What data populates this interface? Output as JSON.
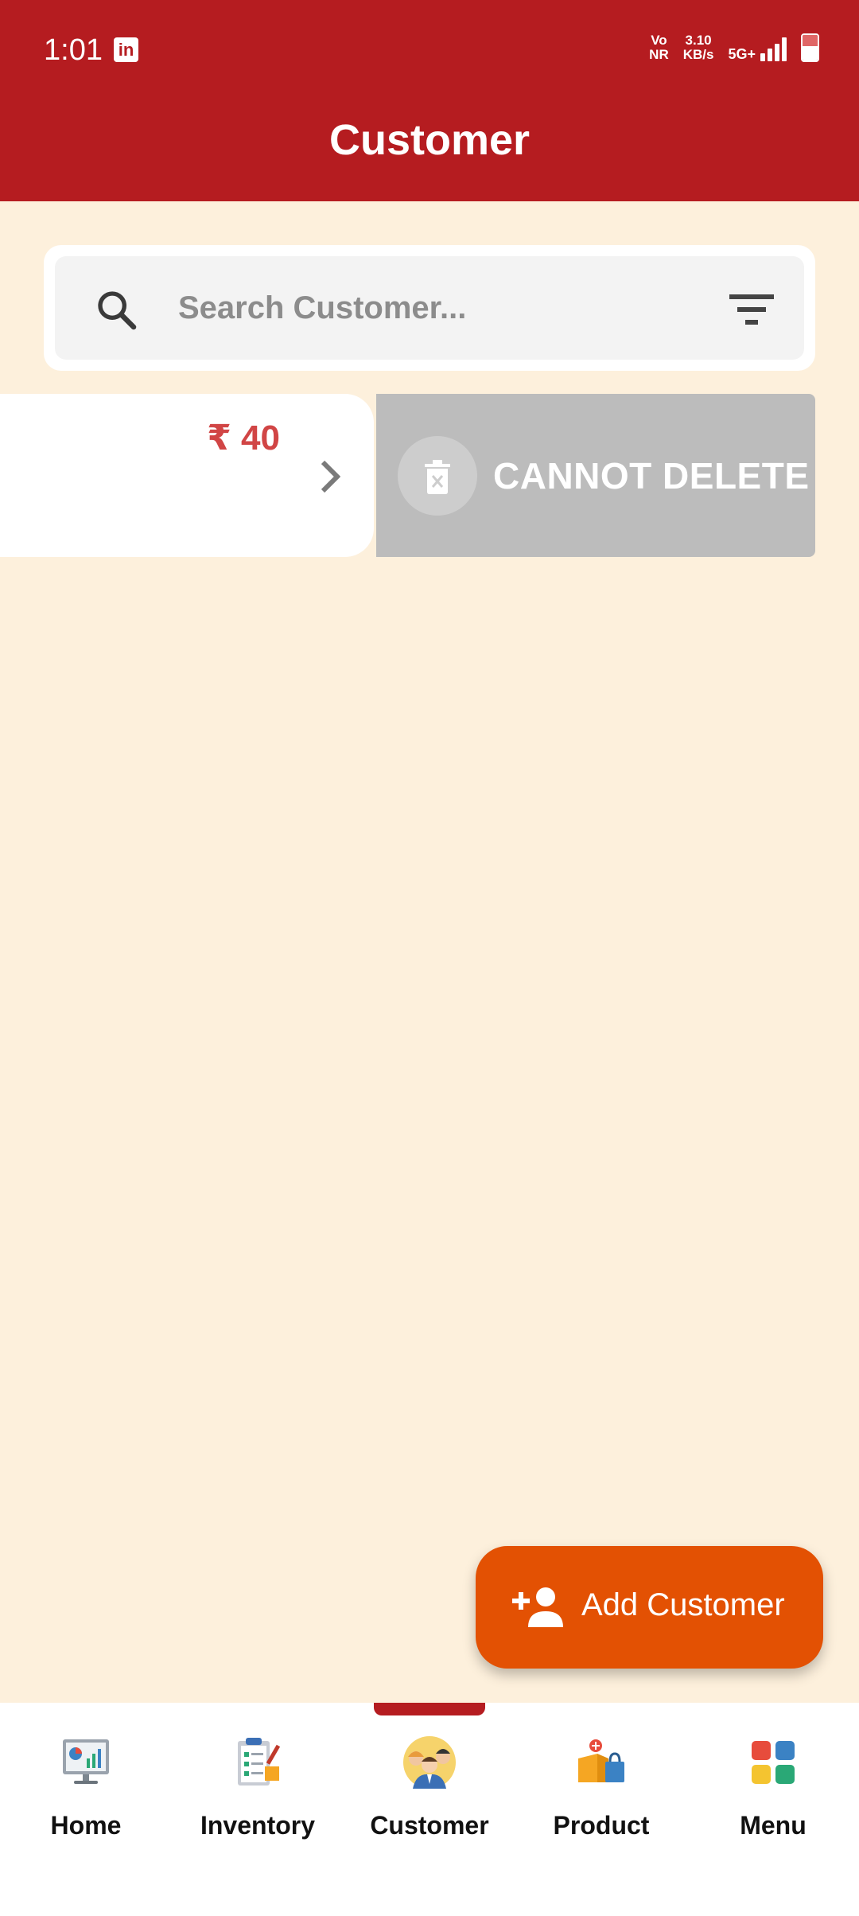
{
  "status_bar": {
    "time": "1:01",
    "linkedin_icon": "in",
    "network_top": "Vo",
    "network_bottom": "NR",
    "speed_value": "3.10",
    "speed_unit": "KB/s",
    "network_type": "5G+"
  },
  "header": {
    "title": "Customer"
  },
  "search": {
    "placeholder": "Search Customer...",
    "value": ""
  },
  "customer_card": {
    "amount": "₹ 40"
  },
  "swipe_action": {
    "label": "CANNOT DELETE"
  },
  "fab": {
    "label": "Add Customer"
  },
  "bottom_nav": {
    "active": "Customer",
    "items": [
      {
        "label": "Home",
        "icon": "dashboard-chart-icon"
      },
      {
        "label": "Inventory",
        "icon": "clipboard-checklist-icon"
      },
      {
        "label": "Customer",
        "icon": "customers-group-icon"
      },
      {
        "label": "Product",
        "icon": "product-box-bag-icon"
      },
      {
        "label": "Menu",
        "icon": "menu-grid-icon"
      }
    ]
  },
  "colors": {
    "header": "#b51c20",
    "background": "#fdf0dc",
    "fab": "#e35103",
    "amount": "#d14545",
    "delete_panel": "#bcbcbc"
  }
}
